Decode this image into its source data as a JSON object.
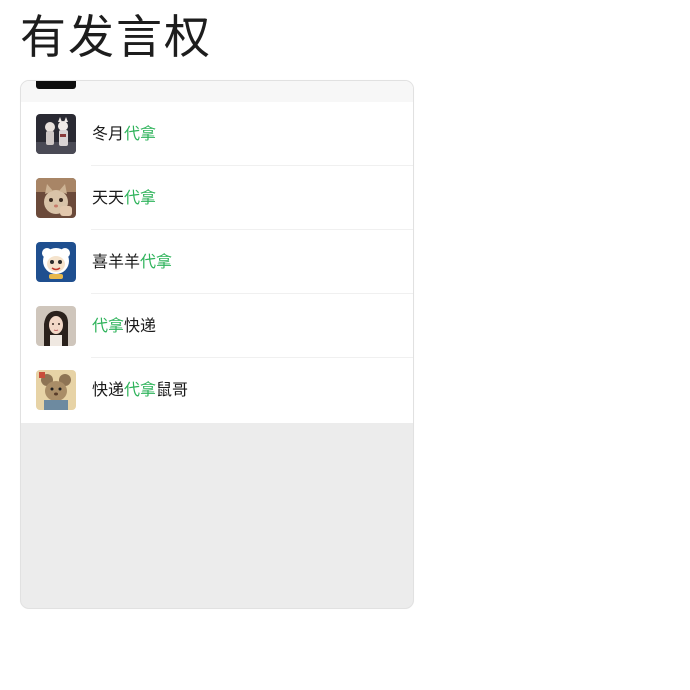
{
  "page": {
    "title": "有发言权"
  },
  "colors": {
    "highlight": "#2fb35b",
    "text": "#1a1a1a",
    "panel_bg": "#ececec"
  },
  "results": [
    {
      "parts": [
        "冬月",
        "代拿",
        ""
      ],
      "avatar": "anime-figures-avatar"
    },
    {
      "parts": [
        "天天",
        "代拿",
        ""
      ],
      "avatar": "cat-photo-avatar"
    },
    {
      "parts": [
        "喜羊羊",
        "代拿",
        ""
      ],
      "avatar": "cartoon-sheep-avatar"
    },
    {
      "parts": [
        "",
        "代拿",
        "快递"
      ],
      "avatar": "woman-portrait-avatar"
    },
    {
      "parts": [
        "快递",
        "代拿",
        "鼠哥"
      ],
      "avatar": "cartoon-mouse-avatar"
    }
  ]
}
